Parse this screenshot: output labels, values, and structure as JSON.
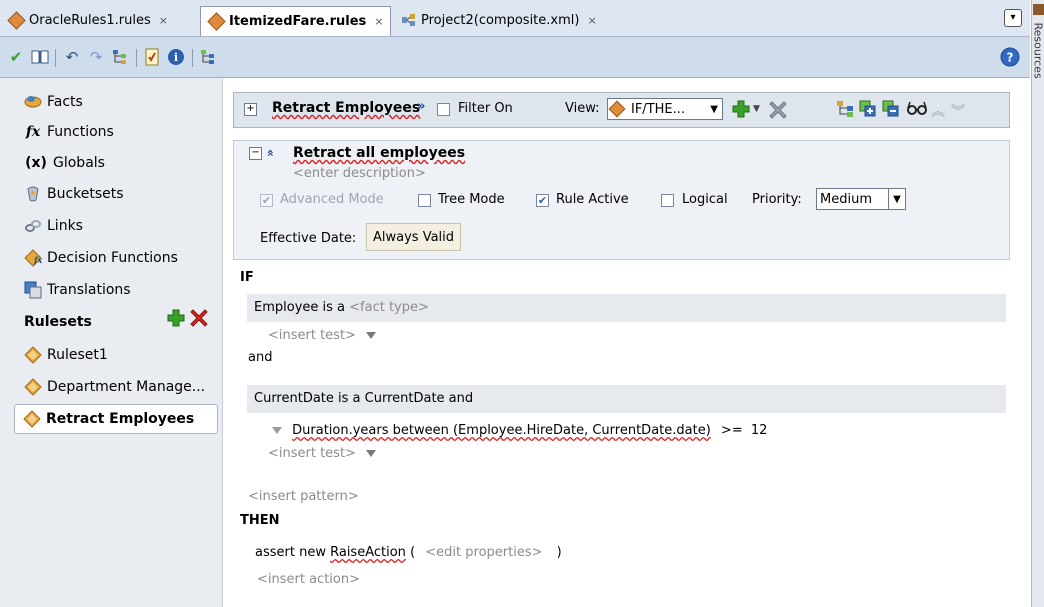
{
  "tabs": [
    {
      "label": "OracleRules1.rules",
      "close": "×"
    },
    {
      "label": "ItemizedFare.rules",
      "close": "×"
    },
    {
      "label": "Project2(composite.xml)",
      "close": "×"
    }
  ],
  "resources_label": "Resources",
  "nav": {
    "items": [
      {
        "label": "Facts",
        "icon": "facts-icon"
      },
      {
        "label": "Functions",
        "icon": "functions-icon"
      },
      {
        "label": "Globals",
        "icon": "globals-icon"
      },
      {
        "label": "Bucketsets",
        "icon": "bucketsets-icon"
      },
      {
        "label": "Links",
        "icon": "links-icon"
      },
      {
        "label": "Decision Functions",
        "icon": "decision-functions-icon"
      },
      {
        "label": "Translations",
        "icon": "translations-icon"
      }
    ],
    "functions_glyph": "fx",
    "globals_glyph": "(x)",
    "rulesets_heading": "Rulesets",
    "rulesets": [
      {
        "label": "Ruleset1"
      },
      {
        "label": "Department Manage..."
      },
      {
        "label": "Retract Employees"
      }
    ]
  },
  "ruleset_header": {
    "title": "Retract Employees",
    "filter_label": "Filter On",
    "view_label": "View:",
    "view_value": "IF/THE..."
  },
  "rule": {
    "name": "Retract all employees",
    "description_placeholder": "<enter description>",
    "advanced_mode_label": "Advanced Mode",
    "tree_mode_label": "Tree Mode",
    "rule_active_label": "Rule Active",
    "logical_label": "Logical",
    "priority_label": "Priority:",
    "priority_value": "Medium",
    "effective_date_label": "Effective Date:",
    "effective_date_value": "Always Valid",
    "advanced_mode_checked": true,
    "tree_mode_checked": false,
    "rule_active_checked": true,
    "logical_checked": false
  },
  "if_section": {
    "keyword": "IF",
    "pattern1_prefix": "Employee is a",
    "pattern1_fact_placeholder": "<fact type>",
    "insert_test": "<insert test>",
    "and_label": "and",
    "pattern2": "CurrentDate is a CurrentDate  and",
    "test_expression": "Duration.years between (Employee.HireDate, CurrentDate.date)",
    "test_operator": ">=",
    "test_value": "12",
    "insert_test2": "<insert test>",
    "insert_pattern": "<insert pattern>"
  },
  "then_section": {
    "keyword": "THEN",
    "action_prefix": "assert new",
    "action_class": "RaiseAction",
    "action_paren_open": "(",
    "edit_properties": "<edit properties>",
    "action_paren_close": ")",
    "insert_action": "<insert action>"
  },
  "colors": {
    "tabbar_bg": "#dde6f1",
    "toolbar_bg": "#cfdcec",
    "nav_bg": "#e9edf2",
    "add_green": "#3aa12a",
    "delete_red": "#d8261c",
    "diamond_orange": "#e08a3c"
  }
}
